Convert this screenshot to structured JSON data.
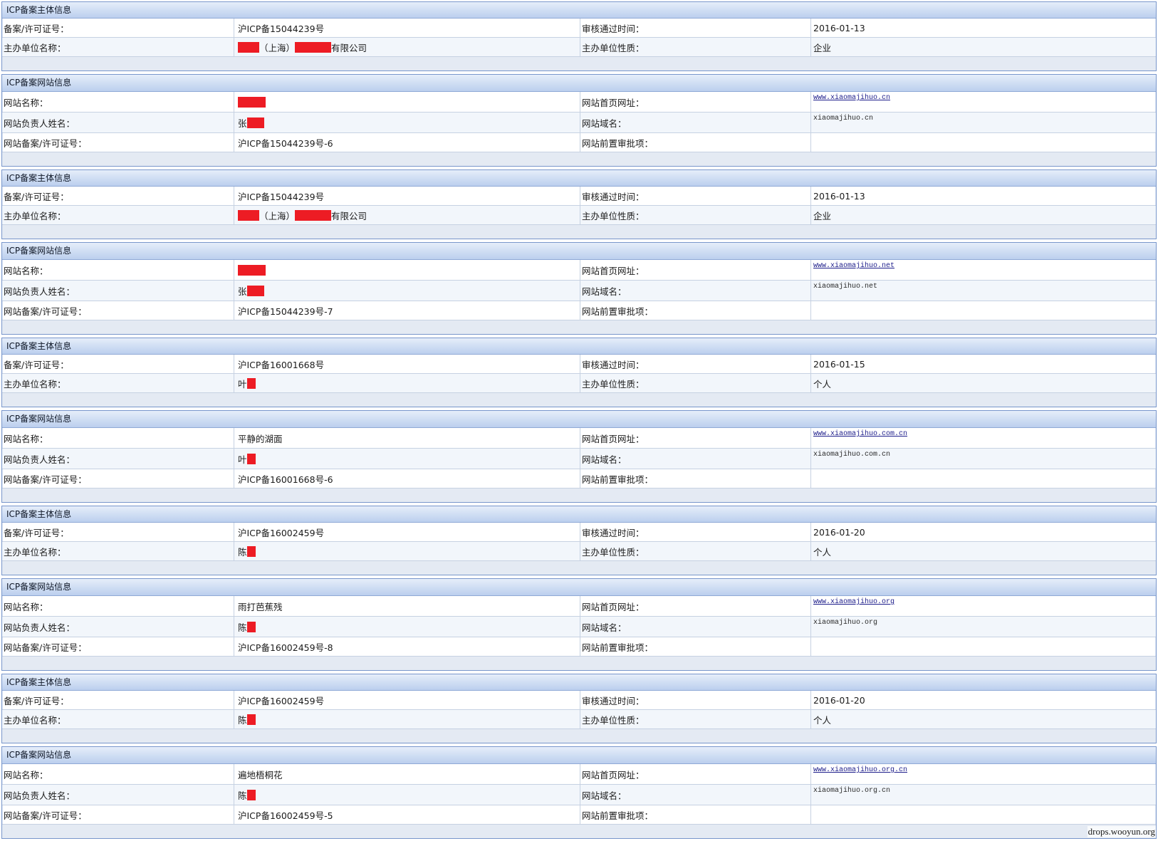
{
  "colors": {
    "redaction": "#ed1c24",
    "link": "#1c1c8a",
    "panel_border": "#7896cb"
  },
  "titles": {
    "subject": "ICP备案主体信息",
    "website": "ICP备案网站信息"
  },
  "labels": {
    "subject": {
      "license": "备案/许可证号：",
      "approved": "审核通过时间：",
      "org_name": "主办单位名称：",
      "org_nature": "主办单位性质："
    },
    "website": {
      "site_name": "网站名称：",
      "homepage": "网站首页网址：",
      "owner": "网站负责人姓名：",
      "domain": "网站域名：",
      "license": "网站备案/许可证号：",
      "pre_approval": "网站前置审批项："
    }
  },
  "panels": [
    {
      "license_no": "沪ICP备15044239号",
      "approved_date": "2016-01-13",
      "org_name": [
        "（上海）",
        "有限公司"
      ],
      "org_nature": "企业"
    },
    {
      "homepage_url": "www.xiaomajihuo.cn",
      "owner_name": "张",
      "domain": "xiaomajihuo.cn",
      "site_license_no": "沪ICP备15044239号-6",
      "pre_approval": ""
    },
    {
      "license_no": "沪ICP备15044239号",
      "approved_date": "2016-01-13",
      "org_name": [
        "（上海）",
        "有限公司"
      ],
      "org_nature": "企业"
    },
    {
      "homepage_url": "www.xiaomajihuo.net",
      "owner_name": "张",
      "domain": "xiaomajihuo.net",
      "site_license_no": "沪ICP备15044239号-7",
      "pre_approval": ""
    },
    {
      "license_no": "沪ICP备16001668号",
      "approved_date": "2016-01-15",
      "org_name": "叶",
      "org_nature": "个人"
    },
    {
      "site_name": "平静的湖面",
      "homepage_url": "www.xiaomajihuo.com.cn",
      "owner_name": "叶",
      "domain": "xiaomajihuo.com.cn",
      "site_license_no": "沪ICP备16001668号-6",
      "pre_approval": ""
    },
    {
      "license_no": "沪ICP备16002459号",
      "approved_date": "2016-01-20",
      "org_name": "陈",
      "org_nature": "个人"
    },
    {
      "site_name": "雨打芭蕉残",
      "homepage_url": "www.xiaomajihuo.org",
      "owner_name": "陈",
      "domain": "xiaomajihuo.org",
      "site_license_no": "沪ICP备16002459号-8",
      "pre_approval": ""
    },
    {
      "license_no": "沪ICP备16002459号",
      "approved_date": "2016-01-20",
      "org_name": "陈",
      "org_nature": "个人"
    },
    {
      "site_name": "遍地梧桐花",
      "homepage_url": "www.xiaomajihuo.org.cn",
      "owner_name": "陈",
      "domain": "xiaomajihuo.org.cn",
      "site_license_no": "沪ICP备16002459号-5",
      "pre_approval": ""
    }
  ],
  "watermark": "drops.wooyun.org"
}
